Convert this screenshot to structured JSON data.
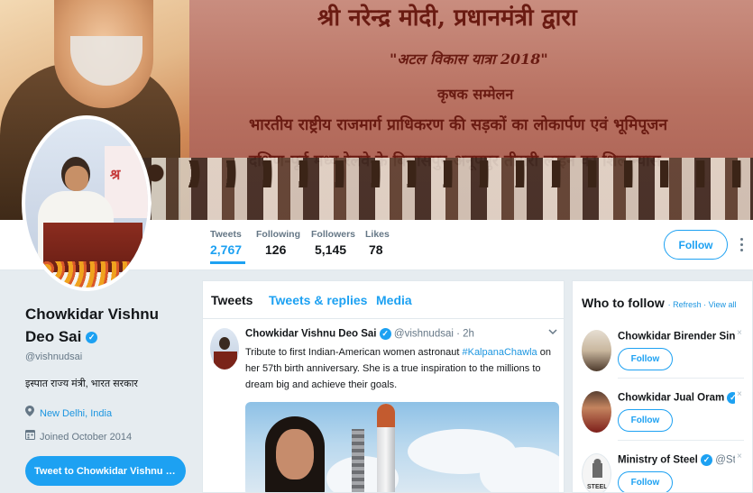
{
  "banner": {
    "hindi_line1": "श्री नरेन्द्र मोदी, प्रधानमंत्री द्वारा",
    "hindi_line2": "\"अटल विकास यात्रा 2018\"",
    "hindi_line3": "कृषक सम्मेलन",
    "hindi_line4": "भारतीय राष्ट्रीय राजमार्ग प्राधिकरण की सड़कों का लोकार्पण एवं भूमिपूजन",
    "hindi_line5": "दक्षिण-पूर्व मध्य रेलवे के बिलासपुर-अनूपपुर तीसरी लाइन का शिलान्यास"
  },
  "stats": [
    {
      "label": "Tweets",
      "value": "2,767"
    },
    {
      "label": "Following",
      "value": "126"
    },
    {
      "label": "Followers",
      "value": "5,145"
    },
    {
      "label": "Likes",
      "value": "78"
    }
  ],
  "follow_label": "Follow",
  "profile": {
    "name": "Chowkidar Vishnu Deo Sai",
    "verified_glyph": "✓",
    "handle": "@vishnudsai",
    "bio": "इस्पात राज्य मंत्री, भारत सरकार",
    "location": "New Delhi, India",
    "joined": "Joined October 2014",
    "tweet_to_label": "Tweet to Chowkidar Vishnu Deo Sai"
  },
  "timeline": {
    "tabs": [
      "Tweets",
      "Tweets & replies",
      "Media"
    ],
    "tweet": {
      "author": "Chowkidar Vishnu Deo Sai",
      "handle": "@vishnudsai",
      "time": "· 2h",
      "text_before": "Tribute to first Indian-American women astronaut ",
      "hashtag": "#KalpanaChawla",
      "text_after": " on her 57th birth anniversary. She is a true inspiration to the millions to dream big and achieve their goals."
    }
  },
  "who_to_follow": {
    "title": "Who to follow",
    "refresh": "Refresh",
    "view_all": "View all",
    "suggestions": [
      {
        "name": "Chowkidar Birender Singh",
        "handle": ""
      },
      {
        "name": "Chowkidar Jual Oram",
        "handle": "@..."
      },
      {
        "name": "Ministry of Steel",
        "handle": "@Ste..."
      }
    ],
    "follow_label": "Follow",
    "close_glyph": "×"
  },
  "icons": {
    "location": "location-pin-icon",
    "calendar": "calendar-icon",
    "verified": "verified-badge-icon",
    "more": "more-vertical-icon",
    "caret": "chevron-down-icon"
  },
  "colors": {
    "accent": "#1da1f2",
    "link": "#1b95e0",
    "background": "#e6ecf0",
    "muted": "#657786"
  }
}
